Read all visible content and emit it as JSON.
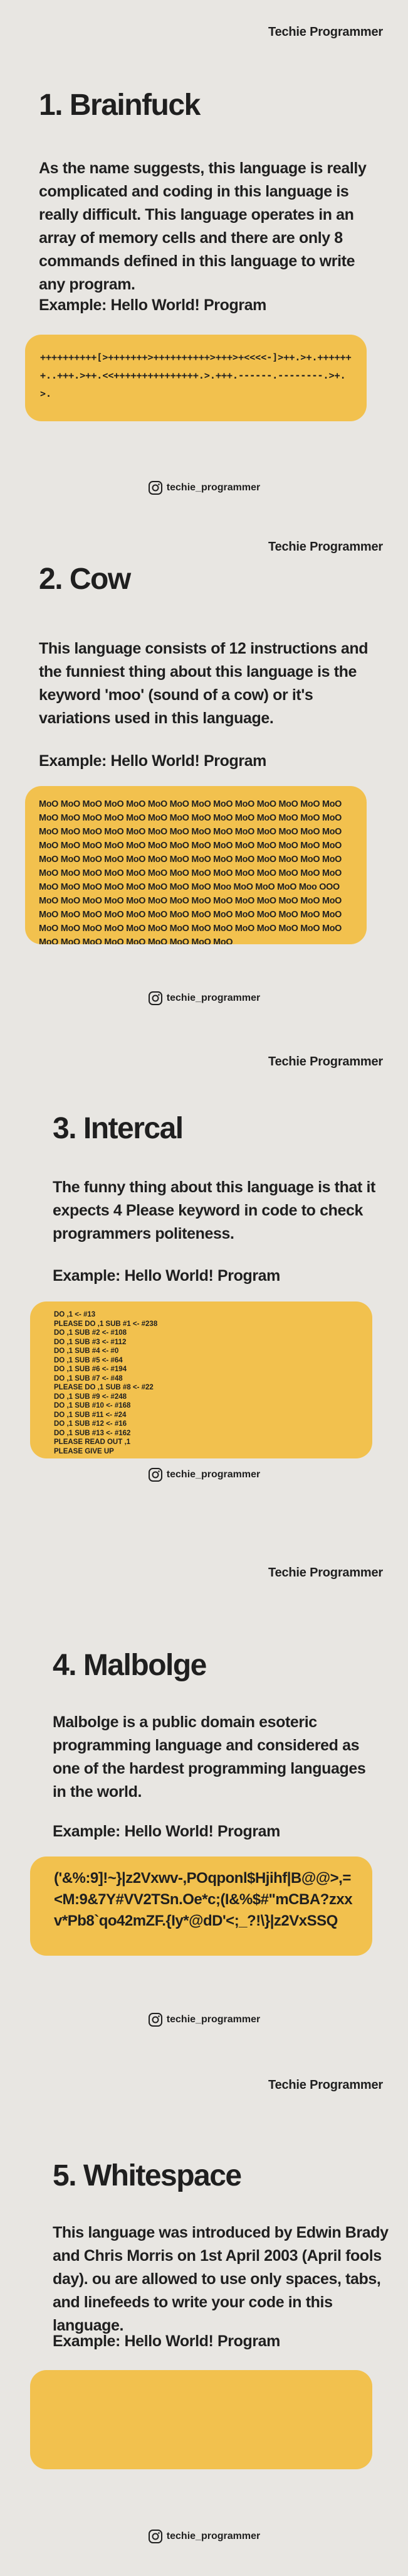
{
  "brand": "Techie Programmer",
  "footer_handle": "techie_programmer",
  "colors": {
    "background": "#e8e6e2",
    "code_box": "#f2c14e",
    "text": "#1f1f1f"
  },
  "slides": [
    {
      "title": "1. Brainfuck",
      "description": "As the name suggests, this language is really complicated and coding in this language is really difficult. This language operates in an array of memory cells and there are only 8 commands defined in this language to write any program.",
      "example_label": "Example: Hello World! Program",
      "code": "++++++++++[>+++++++>++++++++++>+++>+<<<<-]>++.>+.+++++++..+++.>++.<<+++++++++++++++.>.+++.------.--------.>+.>."
    },
    {
      "title": "2. Cow",
      "description": "This language consists of 12 instructions and the funniest thing about this language is the keyword 'moo' (sound of a cow) or it's variations used in this language.",
      "example_label": "Example: Hello World! Program",
      "code": "MoO MoO MoO MoO MoO MoO MoO MoO MoO MoO MoO MoO MoO MoO MoO MoO MoO MoO MoO MoO MoO MoO MoO MoO MoO MoO MoO MoO MoO MoO MoO MoO MoO MoO MoO MoO MoO MoO MoO MoO MoO MoO MoO MoO MoO MoO MoO MoO MoO MoO MoO MoO MoO MoO MoO MoO MoO MoO MoO MoO MoO MoO MoO MoO MoO MoO MoO MoO MoO MoO MoO MoO MoO MoO MoO MoO MoO MoO MoO MoO MoO MoO MoO MoO MoO MoO MoO MoO MoO MoO MoO MoO Moo MoO MoO MoO Moo OOO MoO MoO MoO MoO MoO MoO MoO MoO MoO MoO MoO MoO MoO MoO MoO MoO MoO MoO MoO MoO MoO MoO MoO MoO MoO MoO MoO MoO MoO MoO MoO MoO MoO MoO MoO MoO MoO MoO MoO MoO MoO MoO MoO MoO MoO MoO MoO MoO MoO MoO MoO"
    },
    {
      "title": "3. Intercal",
      "description": "The funny thing about this language is that it expects 4 Please keyword in code to check programmers politeness.",
      "example_label": "Example: Hello World! Program",
      "code_lines": [
        "DO ,1 <- #13",
        "PLEASE DO ,1 SUB #1 <- #238",
        "DO ,1 SUB #2 <- #108",
        "DO ,1 SUB #3 <- #112",
        "DO ,1 SUB #4 <- #0",
        "DO ,1 SUB #5 <- #64",
        "DO ,1 SUB #6 <- #194",
        "DO ,1 SUB #7 <- #48",
        "PLEASE DO ,1 SUB #8 <- #22",
        "DO ,1 SUB #9 <- #248",
        "DO ,1 SUB #10 <- #168",
        "DO ,1 SUB #11 <- #24",
        "DO ,1 SUB #12 <- #16",
        "DO ,1 SUB #13 <- #162",
        "PLEASE READ OUT ,1",
        "PLEASE GIVE UP"
      ]
    },
    {
      "title": "4. Malbolge",
      "description": "Malbolge is a public domain esoteric programming language and considered as one of the hardest programming languages in the world.",
      "example_label": "Example: Hello World! Program",
      "code": "('&%:9]!~}|z2Vxwv-,POqponl$Hjihf|B@@>,=<M:9&7Y#VV2TSn.Oe*c;(I&%$#\"mCBA?zxxv*Pb8`qo42mZF.{Iy*@dD'<;_?!\\}|z2VxSSQ"
    },
    {
      "title": "5. Whitespace",
      "description": "This language was introduced by Edwin Brady and Chris Morris on 1st April 2003 (April fools day). ou are allowed to use only spaces, tabs, and linefeeds to write your code in this language.",
      "example_label": "Example: Hello World! Program",
      "code": ""
    }
  ]
}
